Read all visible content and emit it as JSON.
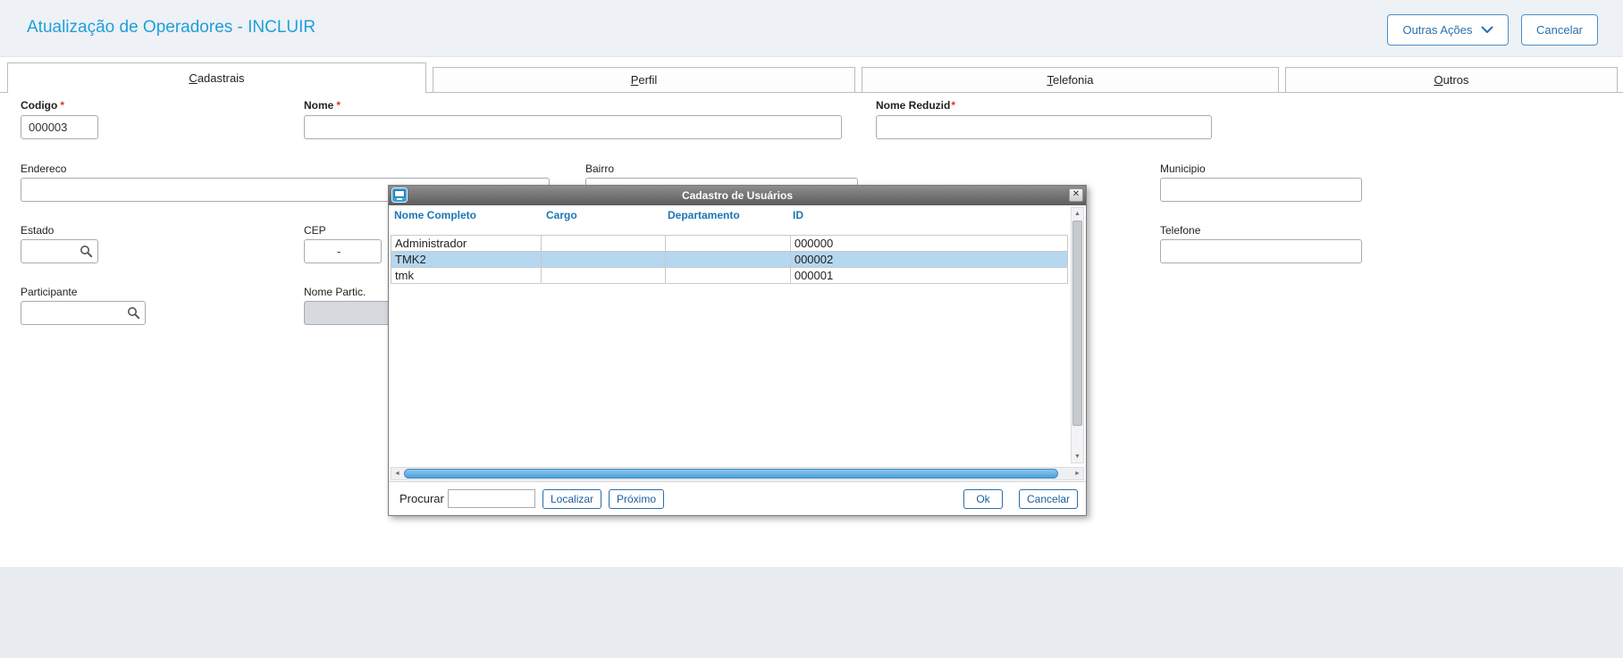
{
  "header": {
    "title": "Atualização de Operadores - INCLUIR",
    "outras_acoes_label": "Outras Ações",
    "cancelar_label": "Cancelar"
  },
  "tabs": [
    {
      "label": "Cadastrais",
      "active": true
    },
    {
      "label": "Perfil",
      "active": false
    },
    {
      "label": "Telefonia",
      "active": false
    },
    {
      "label": "Outros",
      "active": false
    }
  ],
  "form": {
    "required_marker": "*",
    "codigo": {
      "label": "Codigo",
      "required": true,
      "value": "000003"
    },
    "nome": {
      "label": "Nome",
      "required": true,
      "value": ""
    },
    "nome_reduzido": {
      "label": "Nome Reduzid",
      "required": true,
      "value": ""
    },
    "endereco": {
      "label": "Endereco",
      "value": ""
    },
    "bairro": {
      "label": "Bairro",
      "value": ""
    },
    "municipio": {
      "label": "Municipio",
      "value": ""
    },
    "estado": {
      "label": "Estado",
      "value": ""
    },
    "cep": {
      "label": "CEP",
      "value": "-"
    },
    "telefone": {
      "label": "Telefone",
      "value": ""
    },
    "participante": {
      "label": "Participante",
      "value": ""
    },
    "nome_partic": {
      "label": "Nome Partic.",
      "value": "",
      "disabled": true
    }
  },
  "dialog": {
    "title": "Cadastro de Usuários",
    "columns": [
      "Nome Completo",
      "Cargo",
      "Departamento",
      "ID"
    ],
    "rows": [
      {
        "nome": "Administrador",
        "cargo": "",
        "departamento": "",
        "id": "000000",
        "selected": false
      },
      {
        "nome": "TMK2",
        "cargo": "",
        "departamento": "",
        "id": "000002",
        "selected": true
      },
      {
        "nome": "tmk",
        "cargo": "",
        "departamento": "",
        "id": "000001",
        "selected": false
      }
    ],
    "procurar_label": "Procurar",
    "procurar_value": "",
    "localizar_label": "Localizar",
    "proximo_label": "Próximo",
    "ok_label": "Ok",
    "cancelar_label": "Cancelar"
  },
  "icons": {
    "outras_acoes_chevron": "chevron-down",
    "estado_search": "magnifier",
    "participante_search": "magnifier",
    "dialog_app": "monitor",
    "close_glyph": "✕",
    "up_glyph": "▲",
    "down_glyph": "▼",
    "left_glyph": "◄",
    "right_glyph": "►"
  },
  "colors": {
    "accent_blue": "#1f9fd8",
    "button_blue": "#2a6fad",
    "selected_row": "#b5d7ef",
    "required_red": "#e03131",
    "titlebar_gray": "#6e6e6e",
    "hscroll_thumb": "#4d9fd9"
  }
}
